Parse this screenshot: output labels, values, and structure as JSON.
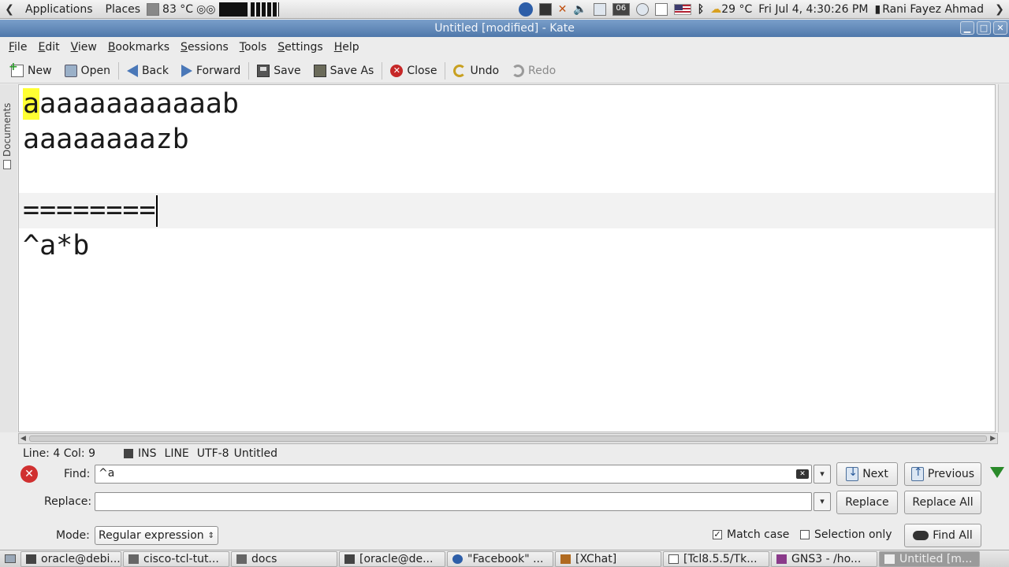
{
  "top_panel": {
    "applications": "Applications",
    "places": "Places",
    "cpu_temp": "83 °C",
    "weather": "29 °C",
    "clock": "Fri Jul  4,  4:30:26 PM",
    "user": "Rani Fayez Ahmad",
    "date_badge": "06"
  },
  "window": {
    "title": "Untitled [modified] - Kate"
  },
  "menubar": [
    "File",
    "Edit",
    "View",
    "Bookmarks",
    "Sessions",
    "Tools",
    "Settings",
    "Help"
  ],
  "toolbar": {
    "new": "New",
    "open": "Open",
    "back": "Back",
    "forward": "Forward",
    "save": "Save",
    "save_as": "Save As",
    "close": "Close",
    "undo": "Undo",
    "redo": "Redo"
  },
  "sidebar": {
    "documents_tab": "Documents"
  },
  "editor": {
    "lines": [
      {
        "match": "a",
        "rest": "aaaaaaaaaaab"
      },
      {
        "text": "aaaaaaaazb"
      },
      {
        "text": ""
      },
      {
        "text": "========"
      },
      {
        "text": "^a*b"
      }
    ]
  },
  "statusbar": {
    "position": "Line: 4 Col: 9",
    "mode": "INS",
    "selection_mode": "LINE",
    "encoding": "UTF-8",
    "filename": "Untitled"
  },
  "find_panel": {
    "find_label": "Find:",
    "find_value": "^a",
    "replace_label": "Replace:",
    "replace_value": "",
    "next": "Next",
    "previous": "Previous",
    "replace": "Replace",
    "replace_all": "Replace All",
    "mode_label": "Mode:",
    "mode_value": "Regular expression",
    "match_case": "Match case",
    "match_case_checked": true,
    "selection_only": "Selection only",
    "selection_only_checked": false,
    "find_all": "Find All"
  },
  "taskbar": [
    {
      "label": "oracle@debi...",
      "active": false
    },
    {
      "label": "cisco-tcl-tut...",
      "active": false
    },
    {
      "label": "docs",
      "active": false
    },
    {
      "label": "[oracle@de...",
      "active": false
    },
    {
      "label": "\"Facebook\" ...",
      "active": false
    },
    {
      "label": "[XChat]",
      "active": false
    },
    {
      "label": "[Tcl8.5.5/Tk...",
      "active": false
    },
    {
      "label": "GNS3 - /ho...",
      "active": false
    },
    {
      "label": "Untitled [m...",
      "active": true
    }
  ],
  "colors": {
    "match_highlight": "#ffff33",
    "titlebar": "#5a82b2",
    "current_line": "#f2f2f2"
  }
}
